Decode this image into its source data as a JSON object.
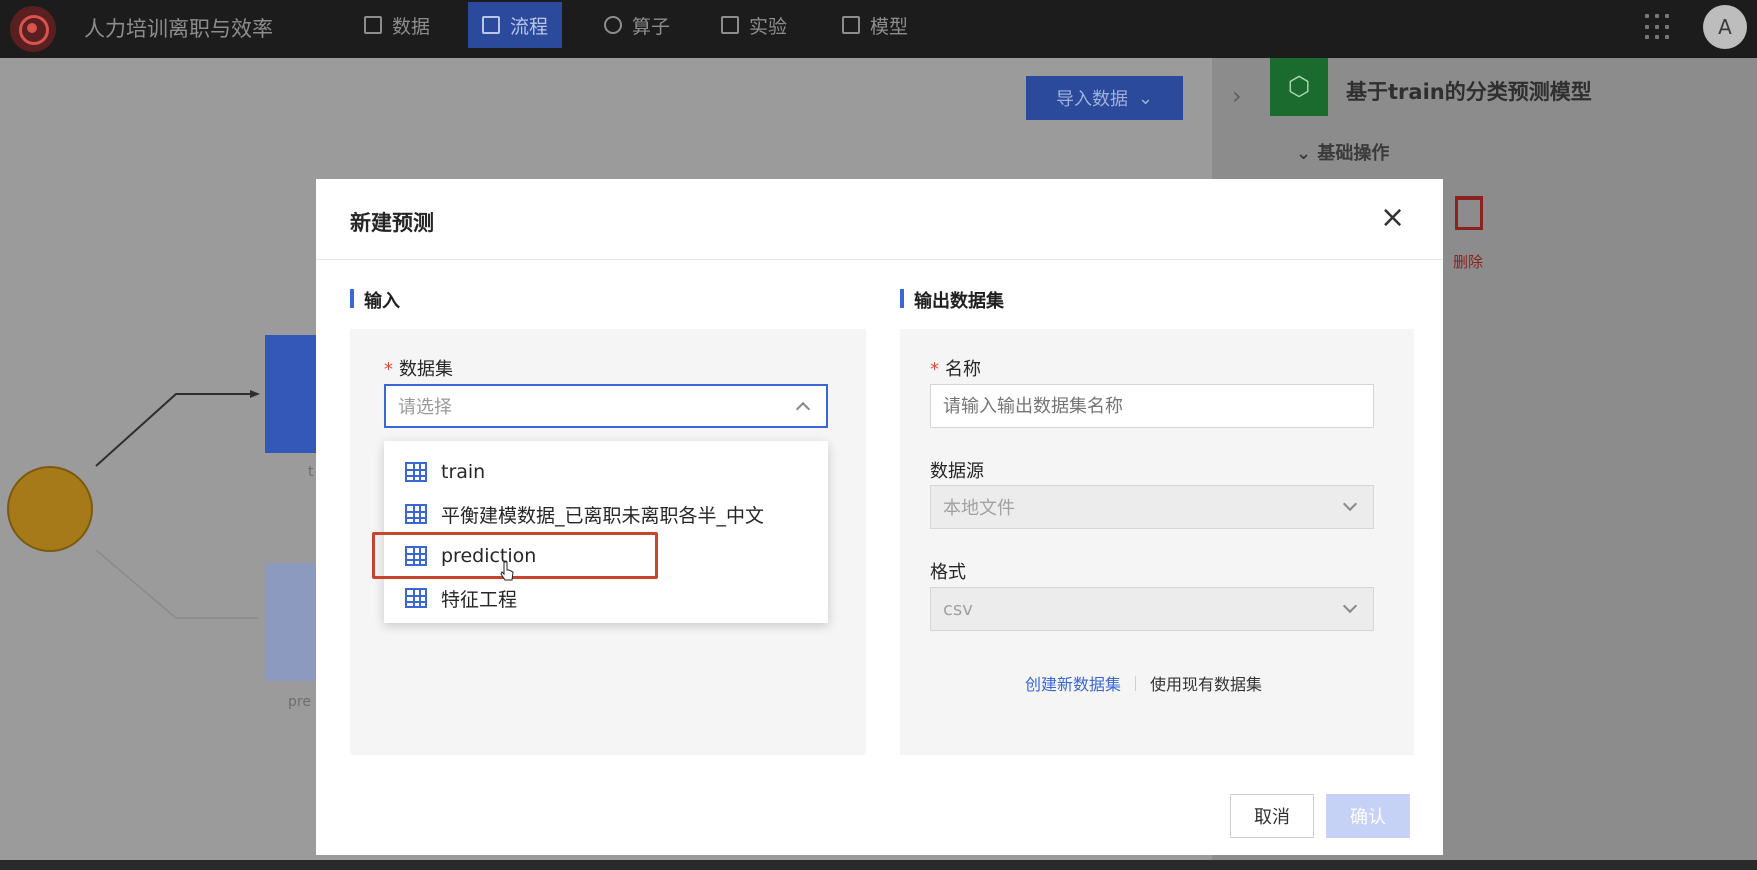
{
  "app": {
    "title": "人力培训离职与效率"
  },
  "nav": [
    {
      "label": "数据",
      "active": false,
      "icon": "table-icon"
    },
    {
      "label": "流程",
      "active": true,
      "icon": "flow-icon"
    },
    {
      "label": "算子",
      "active": false,
      "icon": "operator-icon"
    },
    {
      "label": "实验",
      "active": false,
      "icon": "cube-icon"
    },
    {
      "label": "模型",
      "active": false,
      "icon": "save-icon"
    }
  ],
  "user": {
    "avatar": "A"
  },
  "canvas": {
    "import_label": "导入数据",
    "node_label_1": "t",
    "node_label_2": "pre"
  },
  "right_panel": {
    "title": "基于train的分类预测模型",
    "section": "基础操作",
    "delete_label": "删除"
  },
  "modal": {
    "title": "新建预测",
    "close": "×",
    "input_section": "输入",
    "output_section": "输出数据集",
    "dataset_label": "数据集",
    "dataset_placeholder": "请选择",
    "dataset_options": [
      "train",
      "平衡建模数据_已离职未离职各半_中文",
      "prediction",
      "特征工程"
    ],
    "highlighted_option": "prediction",
    "name_label": "名称",
    "name_placeholder": "请输入输出数据集名称",
    "source_label": "数据源",
    "source_value": "本地文件",
    "format_label": "格式",
    "format_value": "csv",
    "create_new_link": "创建新数据集",
    "use_existing_link": "使用现有数据集",
    "cancel_label": "取消",
    "confirm_label": "确认"
  },
  "colors": {
    "accent": "#3b66d6",
    "required": "#e04a3b",
    "highlight": "#c8442f"
  }
}
